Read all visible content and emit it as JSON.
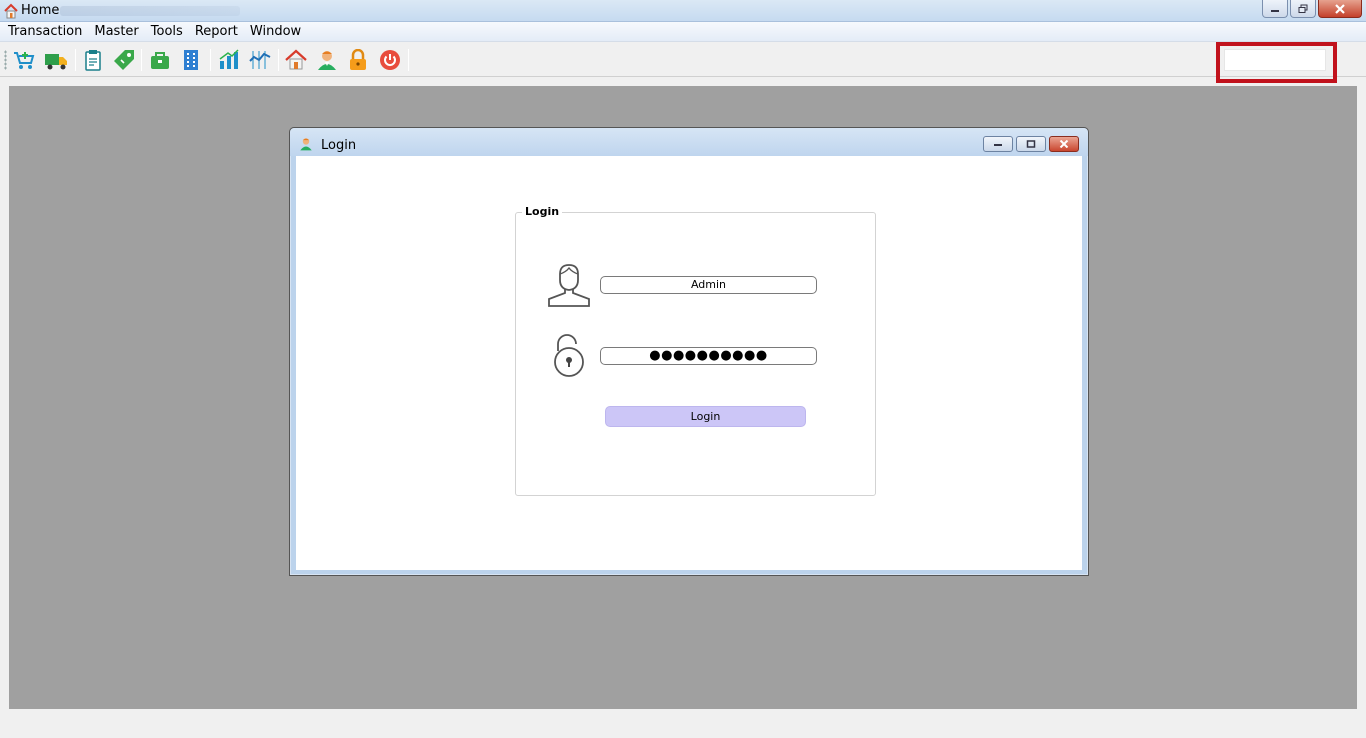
{
  "titlebar": {
    "title": "Home"
  },
  "menu": [
    "Transaction",
    "Master",
    "Tools",
    "Report",
    "Window"
  ],
  "toolbar": {
    "icons": [
      "cart-icon",
      "truck-icon",
      "clipboard-icon",
      "tag-icon",
      "briefcase-icon",
      "building-icon",
      "bar-chart-icon",
      "line-chart-icon",
      "home-icon",
      "user-icon",
      "lock-icon",
      "power-icon"
    ],
    "search_value": ""
  },
  "login_window": {
    "title": "Login",
    "group_label": "Login",
    "username": "Admin",
    "password_mask": "●●●●●●●●●●",
    "login_button": "Login"
  },
  "colors": {
    "mdi_background": "#a0a0a0",
    "login_button": "#ccc6f7",
    "highlight_box": "#c1121c"
  }
}
